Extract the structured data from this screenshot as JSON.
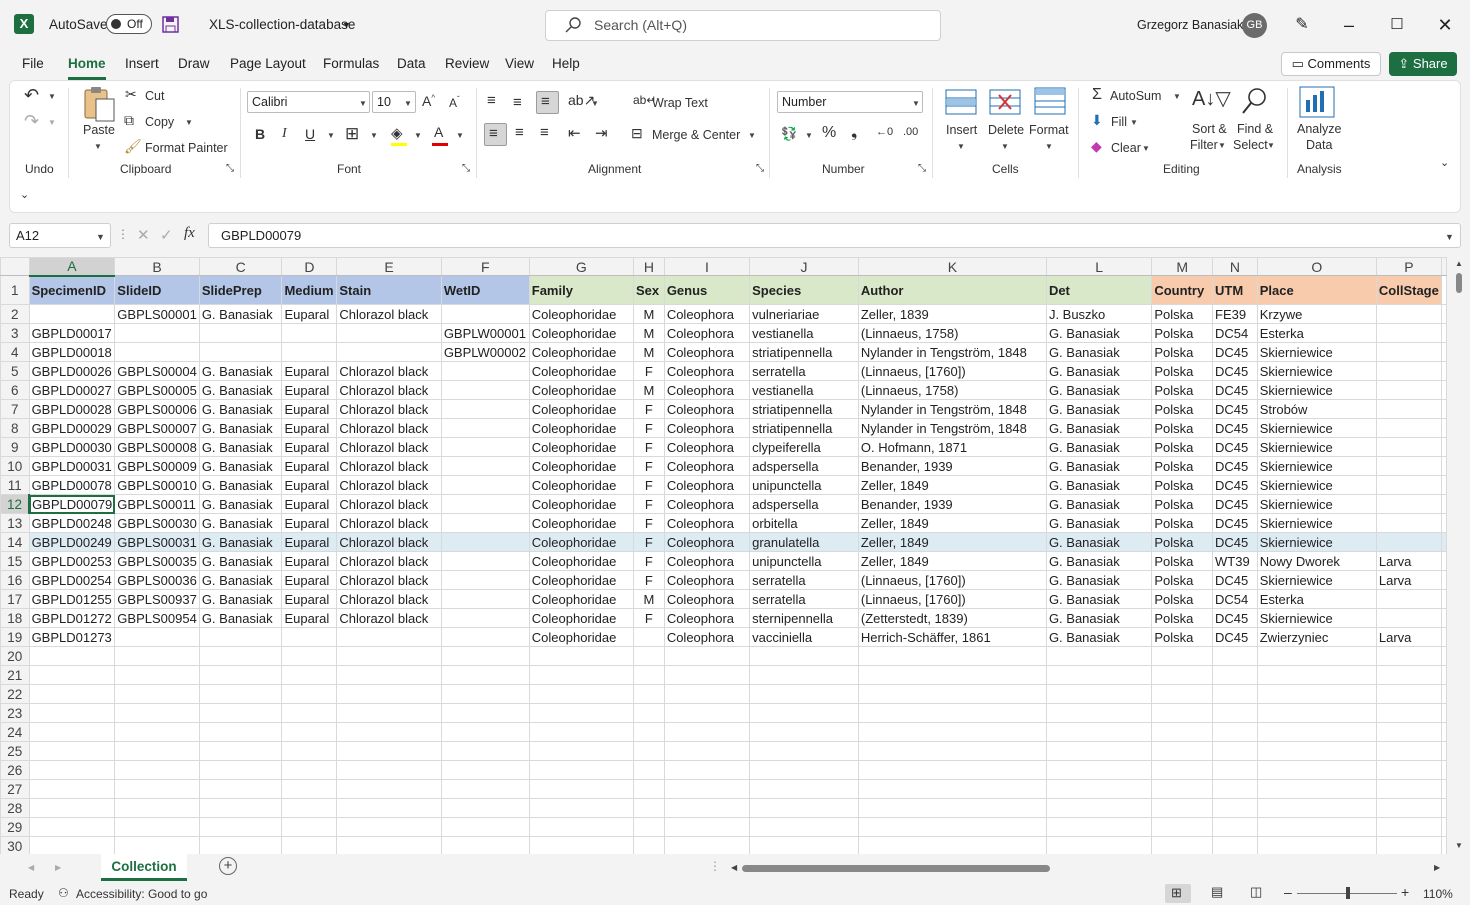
{
  "titlebar": {
    "autosave_label": "AutoSave",
    "autosave_state": "Off",
    "filename": "XLS-collection-database",
    "search_placeholder": "Search (Alt+Q)",
    "user_name": "Grzegorz Banasiak",
    "user_initials": "GB"
  },
  "menu": {
    "tabs": [
      "File",
      "Home",
      "Insert",
      "Draw",
      "Page Layout",
      "Formulas",
      "Data",
      "Review",
      "View",
      "Help"
    ],
    "active": "Home",
    "comments": "Comments",
    "share": "Share"
  },
  "ribbon": {
    "undo_group": "Undo",
    "clipboard": {
      "paste": "Paste",
      "cut": "Cut",
      "copy": "Copy",
      "format_painter": "Format Painter",
      "group": "Clipboard"
    },
    "font": {
      "name": "Calibri",
      "size": "10",
      "group": "Font"
    },
    "alignment": {
      "wrap_text": "Wrap Text",
      "merge_center": "Merge & Center",
      "group": "Alignment"
    },
    "number": {
      "format": "Number",
      "group": "Number"
    },
    "cells": {
      "insert": "Insert",
      "delete": "Delete",
      "format": "Format",
      "group": "Cells"
    },
    "editing": {
      "autosum": "AutoSum",
      "fill": "Fill",
      "clear": "Clear",
      "sort_filter_1": "Sort &",
      "sort_filter_2": "Filter",
      "find_select_1": "Find &",
      "find_select_2": "Select",
      "group": "Editing"
    },
    "analysis": {
      "analyze_1": "Analyze",
      "analyze_2": "Data",
      "group": "Analysis"
    }
  },
  "formula_bar": {
    "name_box": "A12",
    "formula": "GBPLD00079"
  },
  "grid": {
    "columns": [
      "A",
      "B",
      "C",
      "D",
      "E",
      "F",
      "G",
      "H",
      "I",
      "J",
      "K",
      "L",
      "M",
      "N",
      "O",
      "P"
    ],
    "header": [
      "SpecimenID",
      "SlideID",
      "SlidePrep",
      "Medium",
      "Stain",
      "WetID",
      "Family",
      "Sex",
      "Genus",
      "Species",
      "Author",
      "Det",
      "Country",
      "UTM",
      "Place",
      "CollStage"
    ],
    "rows": [
      [
        "",
        "GBPLS00001",
        "G. Banasiak",
        "Euparal",
        "Chlorazol black",
        "",
        "Coleophoridae",
        "M",
        "Coleophora",
        "vulneriariae",
        "Zeller, 1839",
        "J. Buszko",
        "Polska",
        "FE39",
        "Krzywe",
        ""
      ],
      [
        "GBPLD00017",
        "",
        "",
        "",
        "",
        "GBPLW00001",
        "Coleophoridae",
        "M",
        "Coleophora",
        "vestianella",
        "(Linnaeus, 1758)",
        "G. Banasiak",
        "Polska",
        "DC54",
        "Esterka",
        ""
      ],
      [
        "GBPLD00018",
        "",
        "",
        "",
        "",
        "GBPLW00002",
        "Coleophoridae",
        "M",
        "Coleophora",
        "striatipennella",
        "Nylander in Tengström, 1848",
        "G. Banasiak",
        "Polska",
        "DC45",
        "Skierniewice",
        ""
      ],
      [
        "GBPLD00026",
        "GBPLS00004",
        "G. Banasiak",
        "Euparal",
        "Chlorazol black",
        "",
        "Coleophoridae",
        "F",
        "Coleophora",
        "serratella",
        "(Linnaeus, [1760])",
        "G. Banasiak",
        "Polska",
        "DC45",
        "Skierniewice",
        ""
      ],
      [
        "GBPLD00027",
        "GBPLS00005",
        "G. Banasiak",
        "Euparal",
        "Chlorazol black",
        "",
        "Coleophoridae",
        "M",
        "Coleophora",
        "vestianella",
        "(Linnaeus, 1758)",
        "G. Banasiak",
        "Polska",
        "DC45",
        "Skierniewice",
        ""
      ],
      [
        "GBPLD00028",
        "GBPLS00006",
        "G. Banasiak",
        "Euparal",
        "Chlorazol black",
        "",
        "Coleophoridae",
        "F",
        "Coleophora",
        "striatipennella",
        "Nylander in Tengström, 1848",
        "G. Banasiak",
        "Polska",
        "DC45",
        "Strobów",
        ""
      ],
      [
        "GBPLD00029",
        "GBPLS00007",
        "G. Banasiak",
        "Euparal",
        "Chlorazol black",
        "",
        "Coleophoridae",
        "F",
        "Coleophora",
        "striatipennella",
        "Nylander in Tengström, 1848",
        "G. Banasiak",
        "Polska",
        "DC45",
        "Skierniewice",
        ""
      ],
      [
        "GBPLD00030",
        "GBPLS00008",
        "G. Banasiak",
        "Euparal",
        "Chlorazol black",
        "",
        "Coleophoridae",
        "F",
        "Coleophora",
        "clypeiferella",
        "O. Hofmann, 1871",
        "G. Banasiak",
        "Polska",
        "DC45",
        "Skierniewice",
        ""
      ],
      [
        "GBPLD00031",
        "GBPLS00009",
        "G. Banasiak",
        "Euparal",
        "Chlorazol black",
        "",
        "Coleophoridae",
        "F",
        "Coleophora",
        "adspersella",
        "Benander, 1939",
        "G. Banasiak",
        "Polska",
        "DC45",
        "Skierniewice",
        ""
      ],
      [
        "GBPLD00078",
        "GBPLS00010",
        "G. Banasiak",
        "Euparal",
        "Chlorazol black",
        "",
        "Coleophoridae",
        "F",
        "Coleophora",
        "unipunctella",
        "Zeller, 1849",
        "G. Banasiak",
        "Polska",
        "DC45",
        "Skierniewice",
        ""
      ],
      [
        "GBPLD00079",
        "GBPLS00011",
        "G. Banasiak",
        "Euparal",
        "Chlorazol black",
        "",
        "Coleophoridae",
        "F",
        "Coleophora",
        "adspersella",
        "Benander, 1939",
        "G. Banasiak",
        "Polska",
        "DC45",
        "Skierniewice",
        ""
      ],
      [
        "GBPLD00248",
        "GBPLS00030",
        "G. Banasiak",
        "Euparal",
        "Chlorazol black",
        "",
        "Coleophoridae",
        "F",
        "Coleophora",
        "orbitella",
        "Zeller, 1849",
        "G. Banasiak",
        "Polska",
        "DC45",
        "Skierniewice",
        ""
      ],
      [
        "GBPLD00249",
        "GBPLS00031",
        "G. Banasiak",
        "Euparal",
        "Chlorazol black",
        "",
        "Coleophoridae",
        "F",
        "Coleophora",
        "granulatella",
        "Zeller, 1849",
        "G. Banasiak",
        "Polska",
        "DC45",
        "Skierniewice",
        ""
      ],
      [
        "GBPLD00253",
        "GBPLS00035",
        "G. Banasiak",
        "Euparal",
        "Chlorazol black",
        "",
        "Coleophoridae",
        "F",
        "Coleophora",
        "unipunctella",
        "Zeller, 1849",
        "G. Banasiak",
        "Polska",
        "WT39",
        "Nowy Dworek",
        "Larva"
      ],
      [
        "GBPLD00254",
        "GBPLS00036",
        "G. Banasiak",
        "Euparal",
        "Chlorazol black",
        "",
        "Coleophoridae",
        "F",
        "Coleophora",
        "serratella",
        "(Linnaeus, [1760])",
        "G. Banasiak",
        "Polska",
        "DC45",
        "Skierniewice",
        "Larva"
      ],
      [
        "GBPLD01255",
        "GBPLS00937",
        "G. Banasiak",
        "Euparal",
        "Chlorazol black",
        "",
        "Coleophoridae",
        "M",
        "Coleophora",
        "serratella",
        "(Linnaeus, [1760])",
        "G. Banasiak",
        "Polska",
        "DC54",
        "Esterka",
        ""
      ],
      [
        "GBPLD01272",
        "GBPLS00954",
        "G. Banasiak",
        "Euparal",
        "Chlorazol black",
        "",
        "Coleophoridae",
        "F",
        "Coleophora",
        "sternipennella",
        "(Zetterstedt, 1839)",
        "G. Banasiak",
        "Polska",
        "DC45",
        "Skierniewice",
        ""
      ],
      [
        "GBPLD01273",
        "",
        "",
        "",
        "",
        "",
        "Coleophoridae",
        "",
        "Coleophora",
        "vacciniella",
        "Herrich-Schäffer, 1861",
        "G. Banasiak",
        "Polska",
        "DC45",
        "Zwierzyniec",
        "Larva"
      ]
    ],
    "empty_row_numbers": [
      "20",
      "21",
      "22",
      "23",
      "24",
      "25",
      "26",
      "27",
      "28",
      "29",
      "30"
    ],
    "header_colors": {
      "blue": "#b4c6e7",
      "green": "#d9e8c8",
      "orange": "#f8cbad"
    }
  },
  "sheets": {
    "active": "Collection"
  },
  "status": {
    "ready": "Ready",
    "accessibility": "Accessibility: Good to go",
    "zoom": "110%"
  }
}
